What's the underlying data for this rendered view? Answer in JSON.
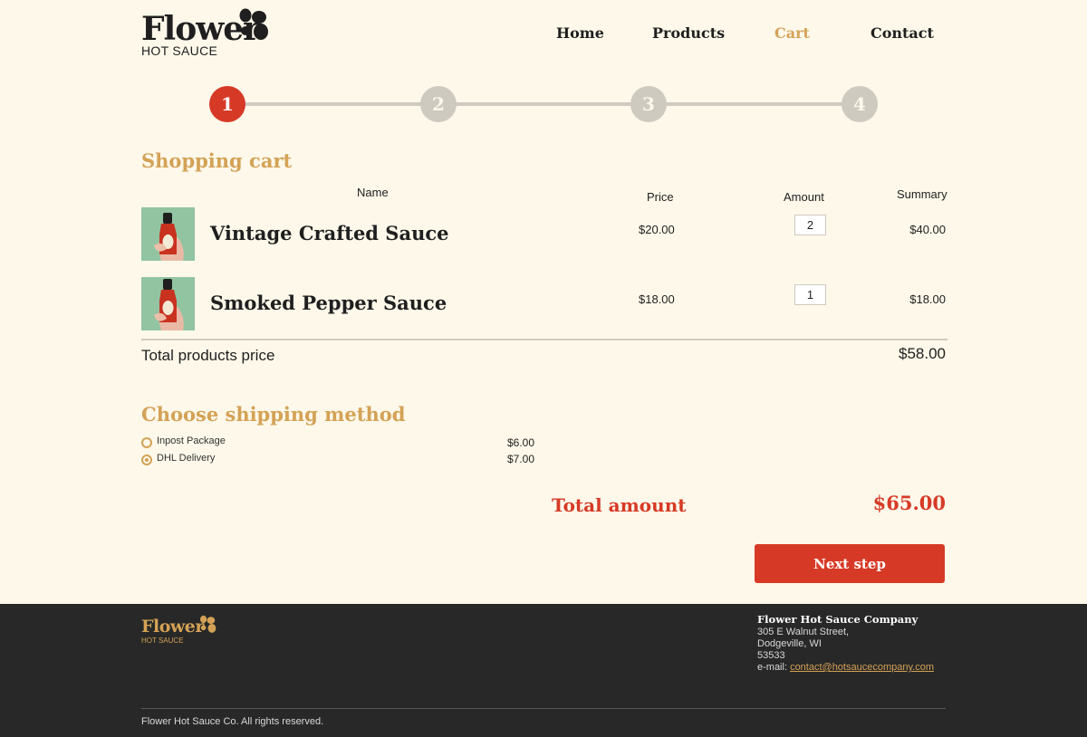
{
  "brand": {
    "name": "Flower",
    "subtitle": "HOT SAUCE"
  },
  "nav": {
    "items": [
      "Home",
      "Products",
      "Cart",
      "Contact"
    ],
    "active": "Cart"
  },
  "stepper": {
    "steps": [
      "1",
      "2",
      "3",
      "4"
    ],
    "current": "1"
  },
  "cart": {
    "title": "Shopping cart",
    "columns": {
      "name": "Name",
      "price": "Price",
      "amount": "Amount",
      "summary": "Summary"
    },
    "items": [
      {
        "name": "Vintage Crafted Sauce",
        "price": "$20.00",
        "amount": "2",
        "summary": "$40.00"
      },
      {
        "name": "Smoked Pepper Sauce",
        "price": "$18.00",
        "amount": "1",
        "summary": "$18.00"
      }
    ],
    "total_label": "Total products price",
    "total_value": "$58.00"
  },
  "shipping": {
    "title": "Choose shipping method",
    "options": [
      {
        "label": "Inpost Package",
        "price": "$6.00",
        "selected": false
      },
      {
        "label": "DHL Delivery",
        "price": "$7.00",
        "selected": true
      }
    ]
  },
  "total": {
    "label": "Total amount",
    "value": "$65.00"
  },
  "next_button": "Next step",
  "footer": {
    "brand_name": "Flower",
    "brand_subtitle": "HOT SAUCE",
    "company": "Flower Hot Sauce Company",
    "address_lines": [
      "305 E Walnut Street,",
      "Dodgeville, WI",
      "53533"
    ],
    "email_prefix": "e-mail: ",
    "email": "contact@hotsaucecompany.com",
    "copyright": "Flower Hot Sauce Co. All rights reserved."
  },
  "colors": {
    "background": "#fdf8ea",
    "accent_gold": "#d4a256",
    "accent_red": "#d63a26",
    "footer_bg": "#282828",
    "inactive_grey": "#cfcac0"
  }
}
